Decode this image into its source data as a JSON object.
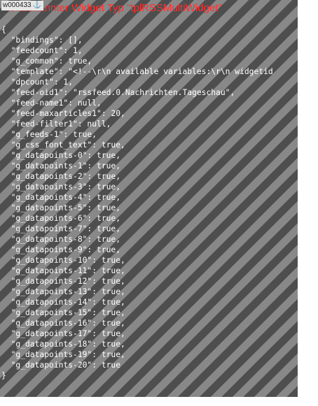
{
  "widget": {
    "id_label": "w000433",
    "error_title": "Unbekannter Widget Typ \"tplRSSMultiWidget\""
  },
  "json_lines": [
    "{",
    "  \"bindings\": [],",
    "  \"feedcount\": 1,",
    "  \"g_common\": true,",
    "  \"template\": \"<!--\\r\\n available variables:\\r\\n widgetid",
    "  \"dpcount\": 1,",
    "  \"feed-oid1\": \"rssfeed.0.Nachrichten.Tageschau\",",
    "  \"feed-name1\": null,",
    "  \"feed-maxarticles1\": 20,",
    "  \"feed-filter1\": null,",
    "  \"g_feeds-1\": true,",
    "  \"g_css_font_text\": true,",
    "  \"g_datapoints-0\": true,",
    "  \"g_datapoints-1\": true,",
    "  \"g_datapoints-2\": true,",
    "  \"g_datapoints-3\": true,",
    "  \"g_datapoints-4\": true,",
    "  \"g_datapoints-5\": true,",
    "  \"g_datapoints-6\": true,",
    "  \"g_datapoints-7\": true,",
    "  \"g_datapoints-8\": true,",
    "  \"g_datapoints-9\": true,",
    "  \"g_datapoints-10\": true,",
    "  \"g_datapoints-11\": true,",
    "  \"g_datapoints-12\": true,",
    "  \"g_datapoints-13\": true,",
    "  \"g_datapoints-14\": true,",
    "  \"g_datapoints-15\": true,",
    "  \"g_datapoints-16\": true,",
    "  \"g_datapoints-17\": true,",
    "  \"g_datapoints-18\": true,",
    "  \"g_datapoints-19\": true,",
    "  \"g_datapoints-20\": true",
    "}"
  ],
  "colors": {
    "stripe_dark": "#4e4e4e",
    "stripe_light": "#888888",
    "error_text": "#ff3030",
    "json_text": "#ffffff"
  },
  "icons": {
    "widget_id": "anchor-icon"
  }
}
